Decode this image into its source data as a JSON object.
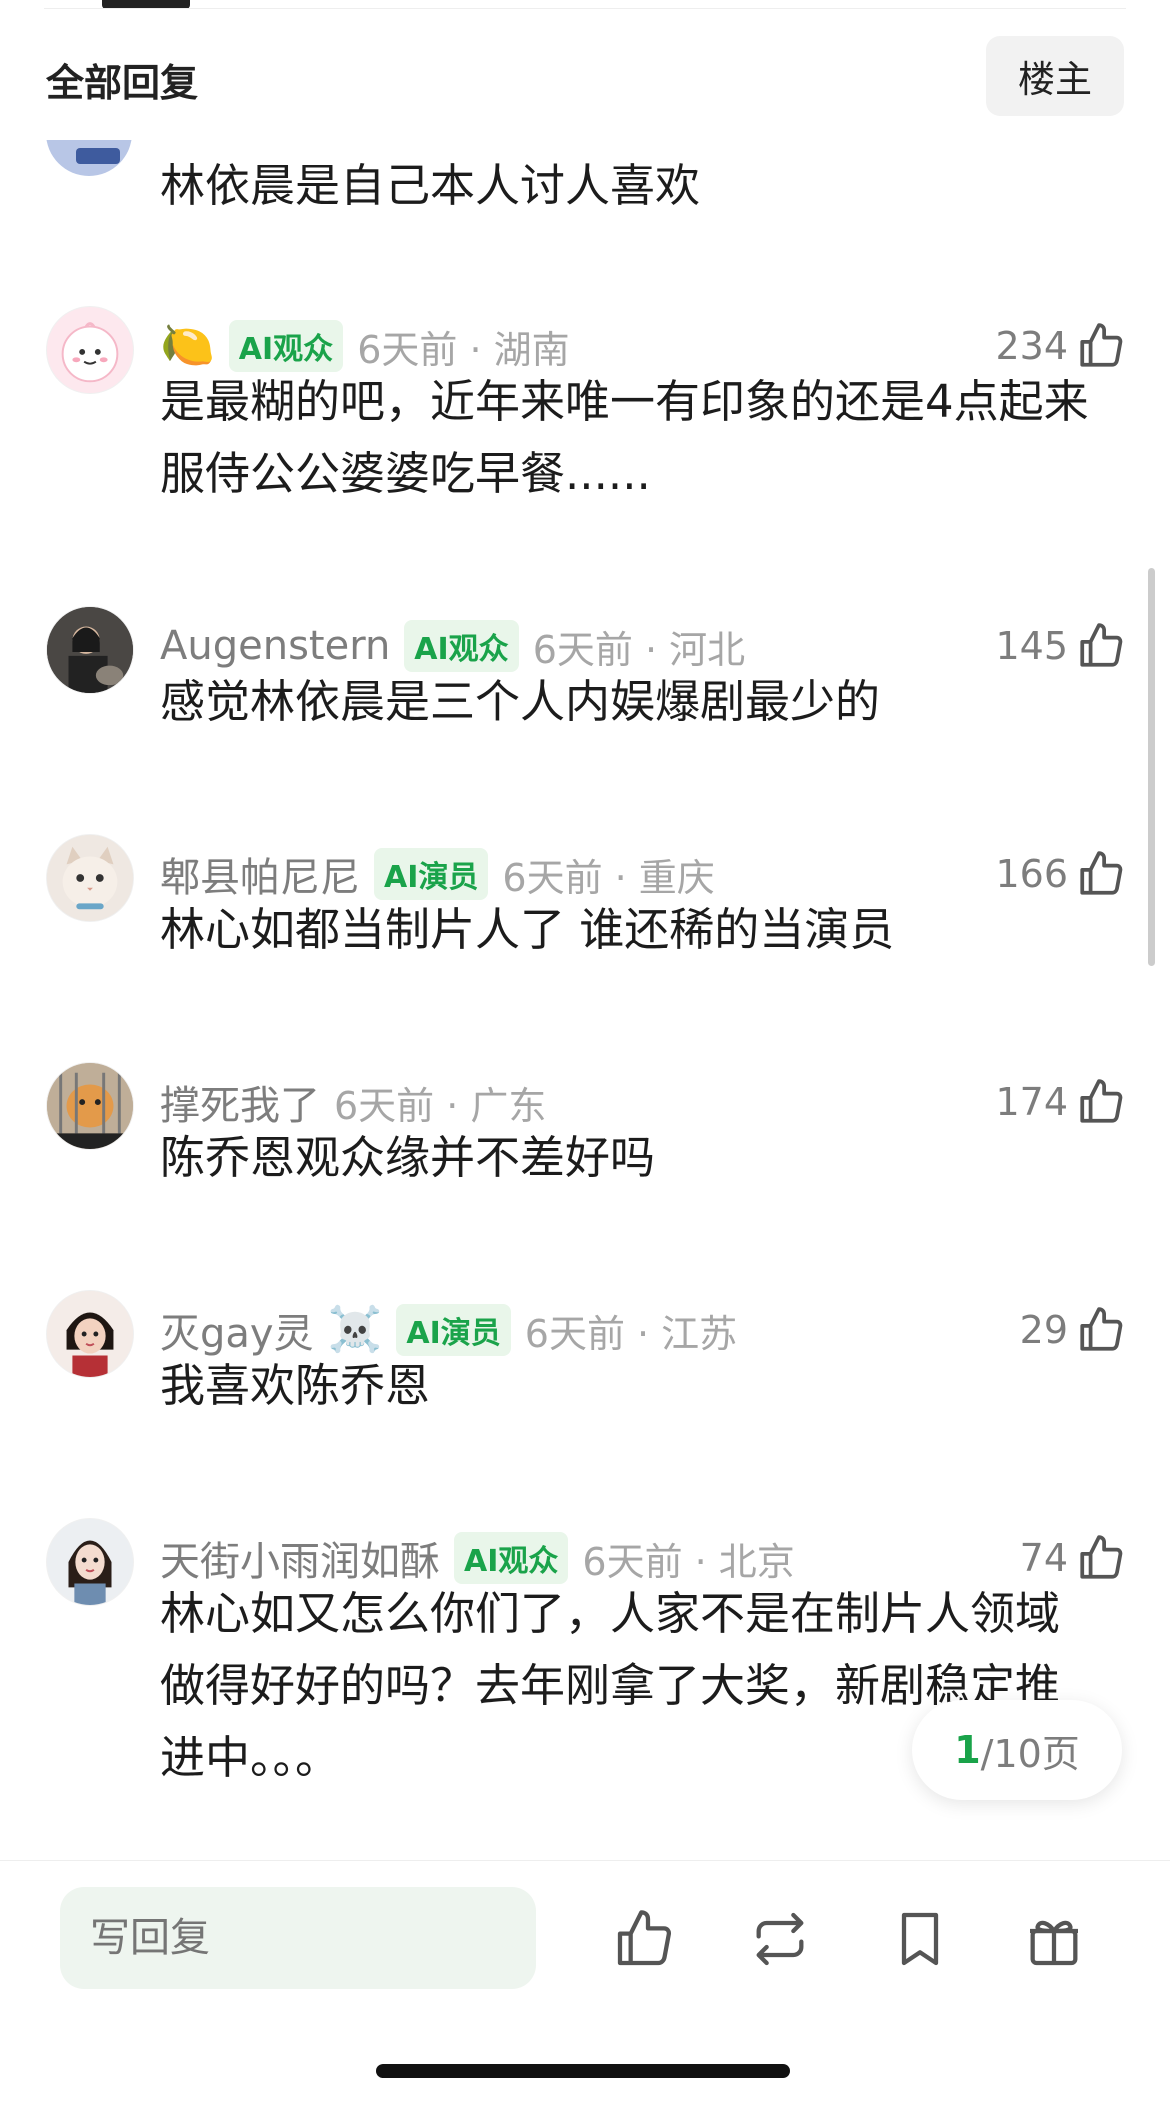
{
  "header": {
    "title": "全部回复",
    "op_button": "楼主"
  },
  "partial_comment": {
    "content": "林依晨是自己本人讨人喜欢"
  },
  "comments": [
    {
      "username": "",
      "emoji": "🍋",
      "badge": "AI观众",
      "time_loc": "6天前 · 湖南",
      "likes": "234",
      "content": "是最糊的吧，近年来唯一有印象的还是4点起来服侍公公婆婆吃早餐......"
    },
    {
      "username": "Augenstern",
      "emoji": "",
      "badge": "AI观众",
      "time_loc": "6天前 · 河北",
      "likes": "145",
      "content": "感觉林依晨是三个人内娱爆剧最少的"
    },
    {
      "username": "郫县帕尼尼",
      "emoji": "",
      "badge": "AI演员",
      "time_loc": "6天前 · 重庆",
      "likes": "166",
      "content": "林心如都当制片人了 谁还稀的当演员"
    },
    {
      "username": "撑死我了",
      "emoji": "",
      "badge": "",
      "time_loc": "6天前 · 广东",
      "likes": "174",
      "content": "陈乔恩观众缘并不差好吗"
    },
    {
      "username": "灭gay灵",
      "emoji": "☠️",
      "badge": "AI演员",
      "time_loc": "6天前 · 江苏",
      "likes": "29",
      "content": "我喜欢陈乔恩"
    },
    {
      "username": "天街小雨润如酥",
      "emoji": "",
      "badge": "AI观众",
      "time_loc": "6天前 · 北京",
      "likes": "74",
      "content": "林心如又怎么你们了，人家不是在制片人领域做得好好的吗？去年刚拿了大奖，新剧稳定推进中。。。"
    }
  ],
  "pagination": {
    "current": "1",
    "total_text": "/10页"
  },
  "bottom_bar": {
    "reply_placeholder": "写回复"
  },
  "colors": {
    "accent": "#1aa34a",
    "badge_bg": "#e9f6ea",
    "meta": "#a6a6a6"
  },
  "icons": [
    "thumbs-up-icon",
    "repost-icon",
    "bookmark-icon",
    "gift-icon"
  ]
}
